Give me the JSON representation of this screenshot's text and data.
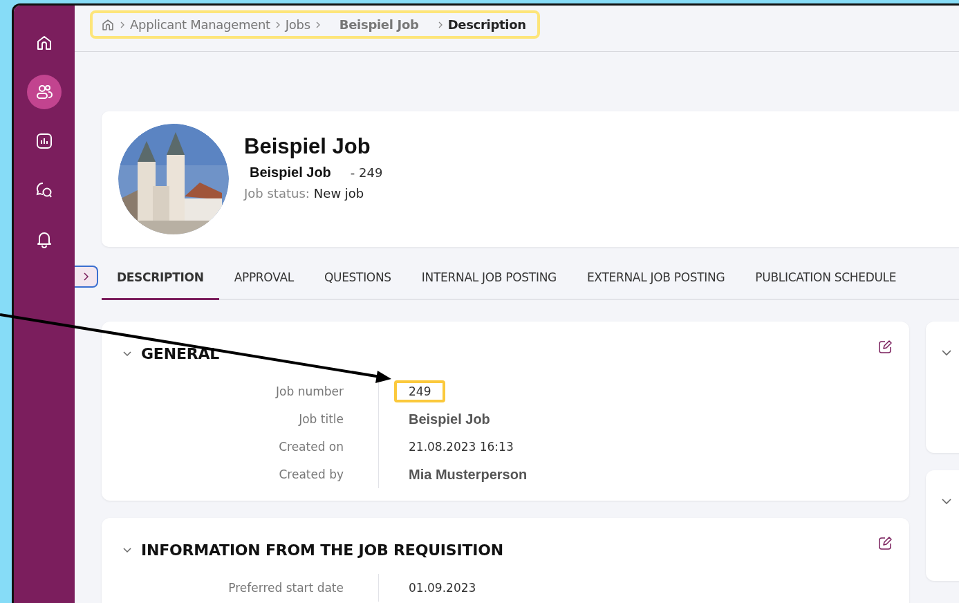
{
  "sidebar": {
    "items": [
      {
        "kind": "home",
        "selected": false
      },
      {
        "kind": "people",
        "selected": true
      },
      {
        "kind": "chart",
        "selected": false
      },
      {
        "kind": "chat",
        "selected": false
      },
      {
        "kind": "bell",
        "selected": false
      }
    ]
  },
  "breadcrumb": {
    "highlighted": true,
    "items": [
      "Applicant Management",
      "Jobs",
      "Beispiel Job",
      "Description"
    ]
  },
  "header": {
    "title": "Beispiel Job",
    "subtitle": "Beispiel Job",
    "number": "- 249",
    "status_label": "Job status:",
    "status_value": "New job"
  },
  "tabs": [
    {
      "label": "DESCRIPTION",
      "selected": true
    },
    {
      "label": "APPROVAL",
      "selected": false
    },
    {
      "label": "QUESTIONS",
      "selected": false
    },
    {
      "label": "INTERNAL JOB POSTING",
      "selected": false
    },
    {
      "label": "EXTERNAL JOB POSTING",
      "selected": false
    },
    {
      "label": "PUBLICATION SCHEDULE",
      "selected": false
    }
  ],
  "sections": [
    {
      "title": "GENERAL",
      "expanded": true,
      "fields": [
        {
          "label": "Job number",
          "value": "249",
          "bold": false,
          "highlighted": true
        },
        {
          "label": "Job title",
          "value": "Beispiel Job",
          "bold": true,
          "highlighted": false
        },
        {
          "label": "Created on",
          "value": "21.08.2023 16:13",
          "bold": false,
          "highlighted": false
        },
        {
          "label": "Created by",
          "value": "Mia Musterperson",
          "bold": true,
          "highlighted": false
        }
      ]
    },
    {
      "title": "INFORMATION FROM THE JOB REQUISITION",
      "expanded": true,
      "fields": [
        {
          "label": "Preferred start date",
          "value": "01.09.2023",
          "bold": false,
          "highlighted": false
        }
      ]
    }
  ]
}
